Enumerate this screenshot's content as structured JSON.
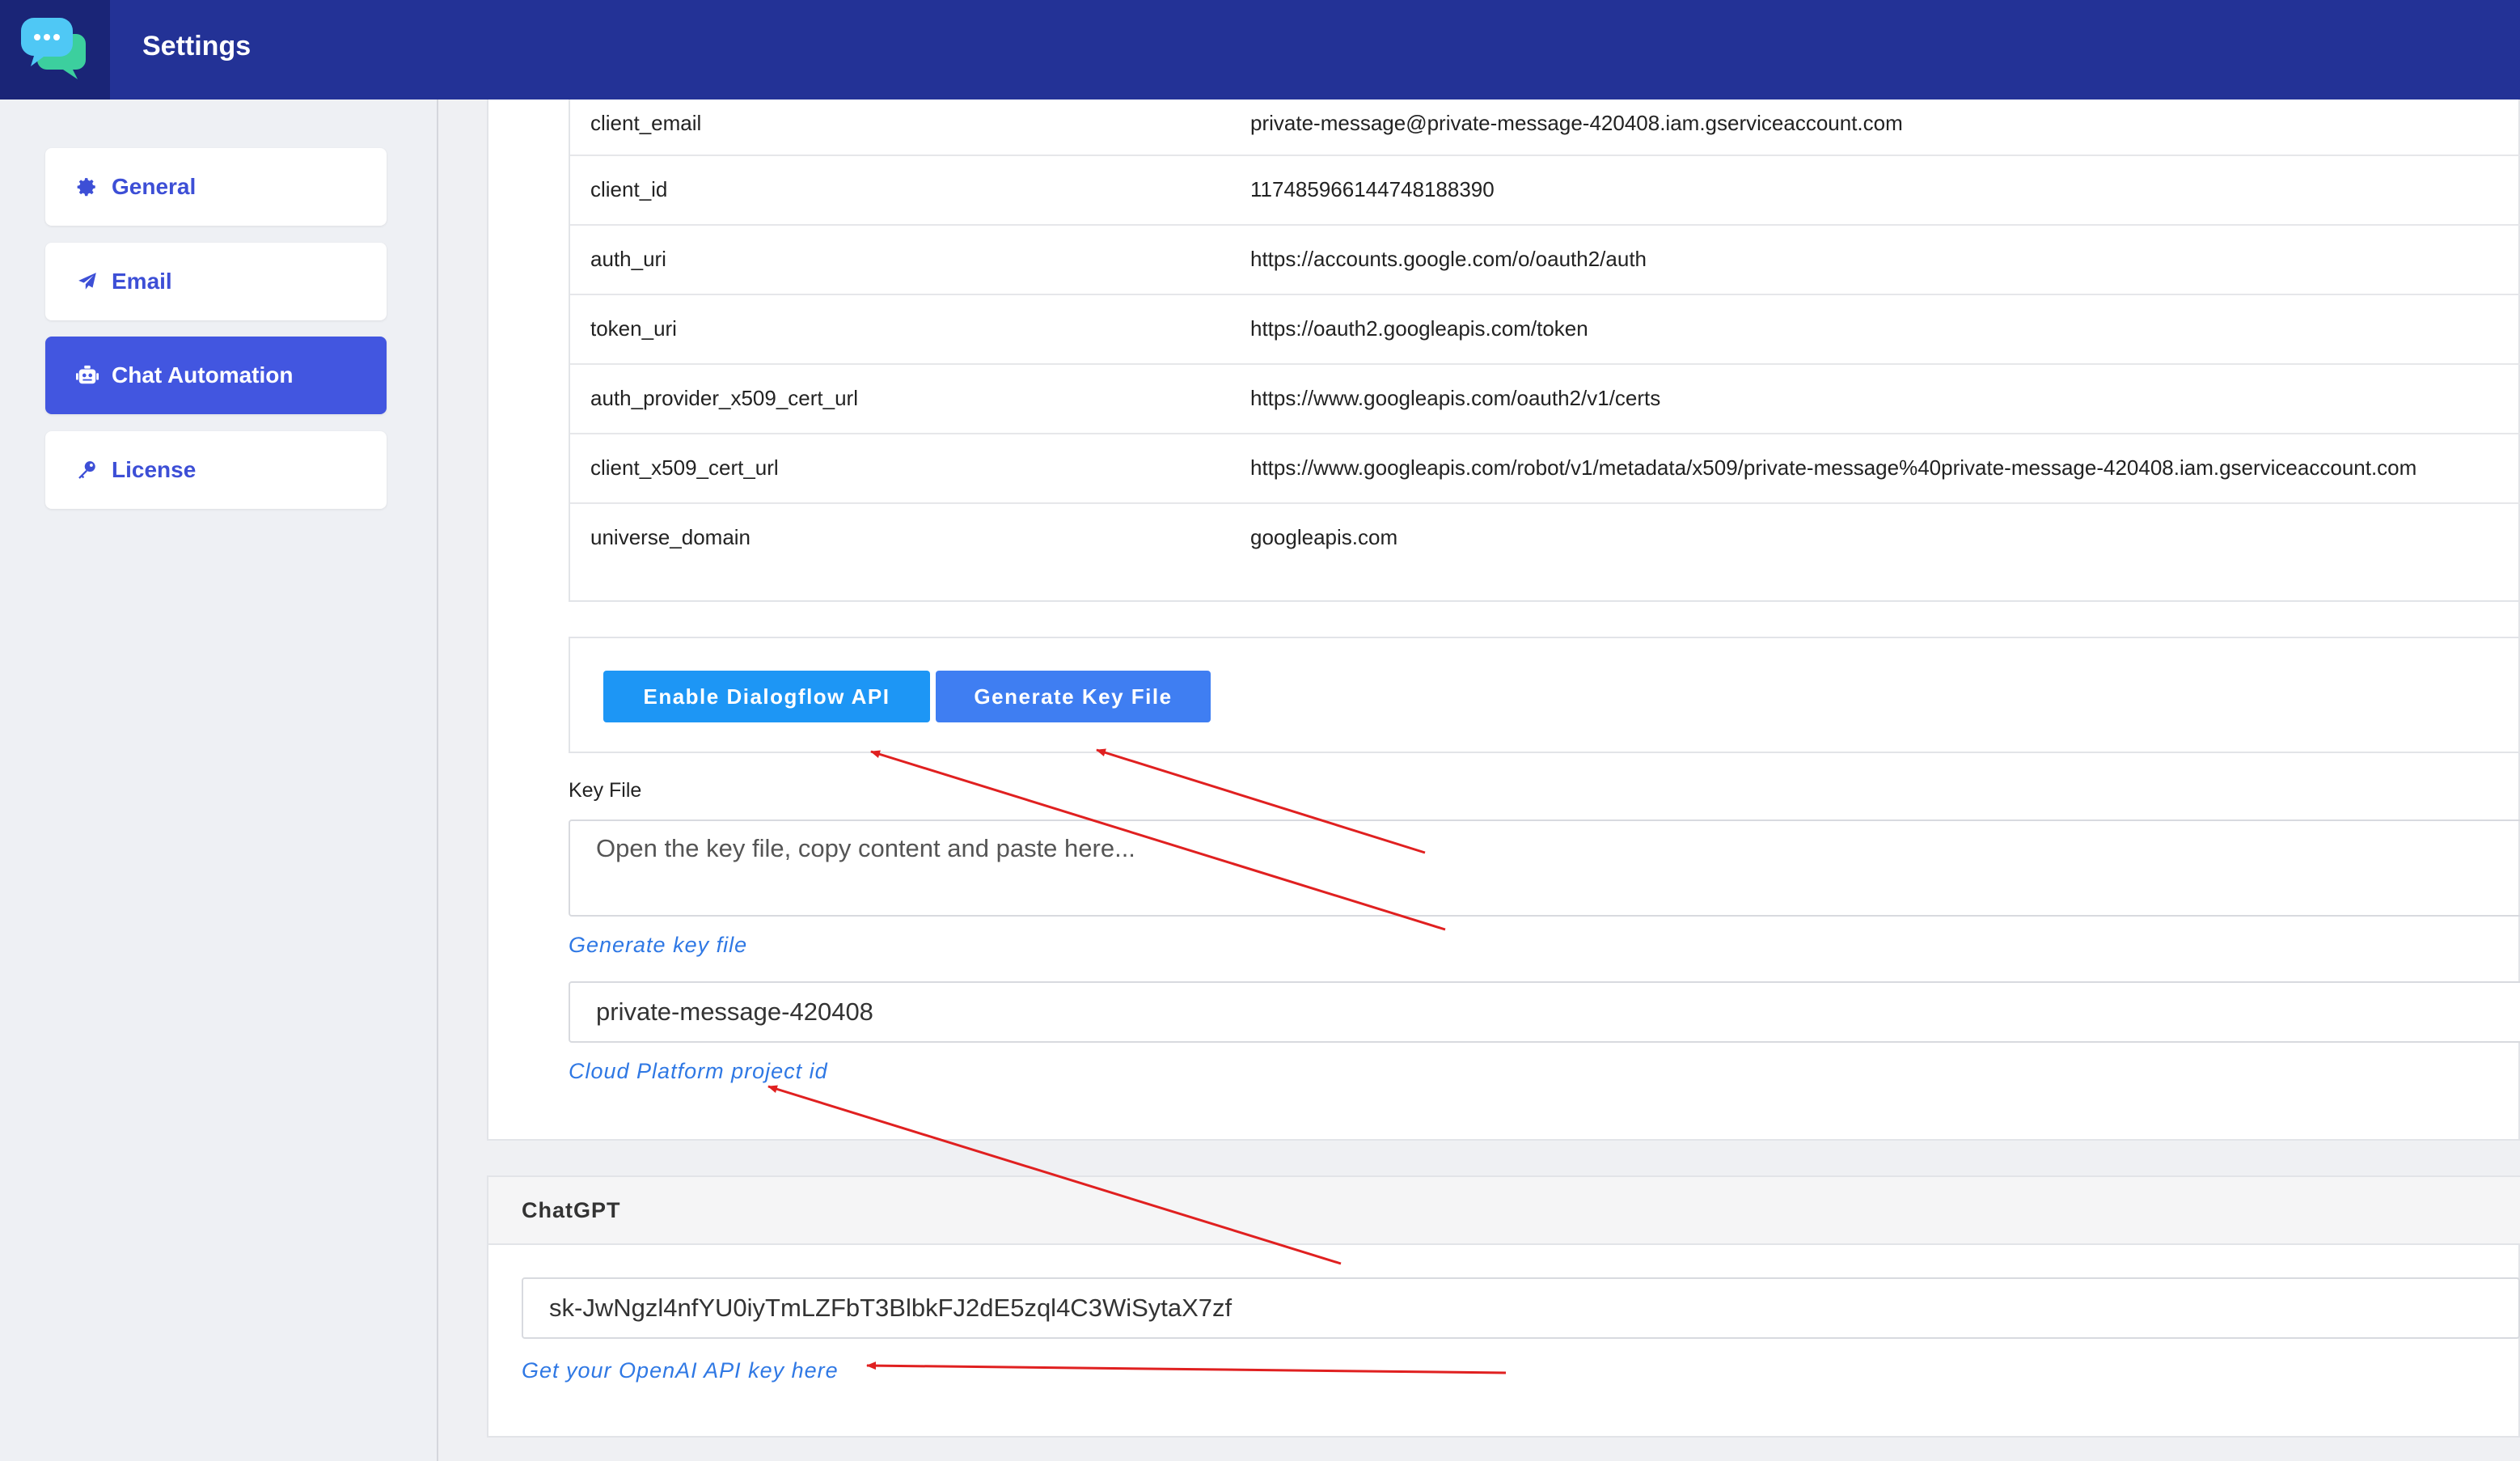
{
  "header": {
    "title": "Settings"
  },
  "sidebar": {
    "items": [
      {
        "label": "General",
        "icon": "gear-icon"
      },
      {
        "label": "Email",
        "icon": "paper-plane-icon"
      },
      {
        "label": "Chat Automation",
        "icon": "robot-icon",
        "active": true
      },
      {
        "label": "License",
        "icon": "key-icon"
      }
    ]
  },
  "credentials": {
    "rows": [
      {
        "key": "client_email",
        "value": "private-message@private-message-420408.iam.gserviceaccount.com"
      },
      {
        "key": "client_id",
        "value": "117485966144748188390"
      },
      {
        "key": "auth_uri",
        "value": "https://accounts.google.com/o/oauth2/auth"
      },
      {
        "key": "token_uri",
        "value": "https://oauth2.googleapis.com/token"
      },
      {
        "key": "auth_provider_x509_cert_url",
        "value": "https://www.googleapis.com/oauth2/v1/certs"
      },
      {
        "key": "client_x509_cert_url",
        "value": "https://www.googleapis.com/robot/v1/metadata/x509/private-message%40private-message-420408.iam.gserviceaccount.com"
      },
      {
        "key": "universe_domain",
        "value": "googleapis.com"
      }
    ]
  },
  "dialogflow": {
    "enable_button": "Enable Dialogflow API",
    "generate_button": "Generate Key File",
    "key_file_label": "Key File",
    "key_file_placeholder": "Open the key file, copy content and paste here...",
    "key_file_help": "Generate key file",
    "project_id_value": "private-message-420408",
    "project_id_help": "Cloud Platform project id"
  },
  "chatgpt": {
    "title": "ChatGPT",
    "api_key_value": "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",
    "api_key_help": "Get your OpenAI API key here"
  },
  "colors": {
    "header": "#233296",
    "active_nav": "#4256e0",
    "link": "#2f78e4",
    "annotation_arrow": "#e02020"
  }
}
